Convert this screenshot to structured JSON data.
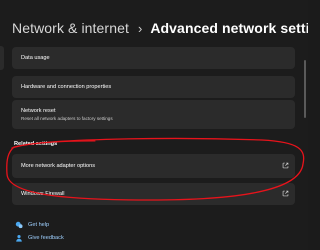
{
  "header": {
    "parent": "Network & internet",
    "separator": "›",
    "current": "Advanced network settings"
  },
  "cards": {
    "data_usage": "Data usage",
    "hardware": "Hardware and connection properties",
    "network_reset_title": "Network reset",
    "network_reset_sub": "Reset all network adapters to factory settings"
  },
  "related": {
    "label": "Related settings",
    "more_adapter": "More network adapter options",
    "firewall": "Windows Firewall"
  },
  "footer": {
    "help": "Get help",
    "feedback": "Give feedback"
  },
  "colors": {
    "background": "#1c1c1c",
    "card": "#2b2b2b",
    "link": "#9fd0ff",
    "annotation": "#e8131b"
  },
  "icons": {
    "external_link": "external-link-icon",
    "help": "help-icon",
    "feedback": "feedback-icon"
  }
}
